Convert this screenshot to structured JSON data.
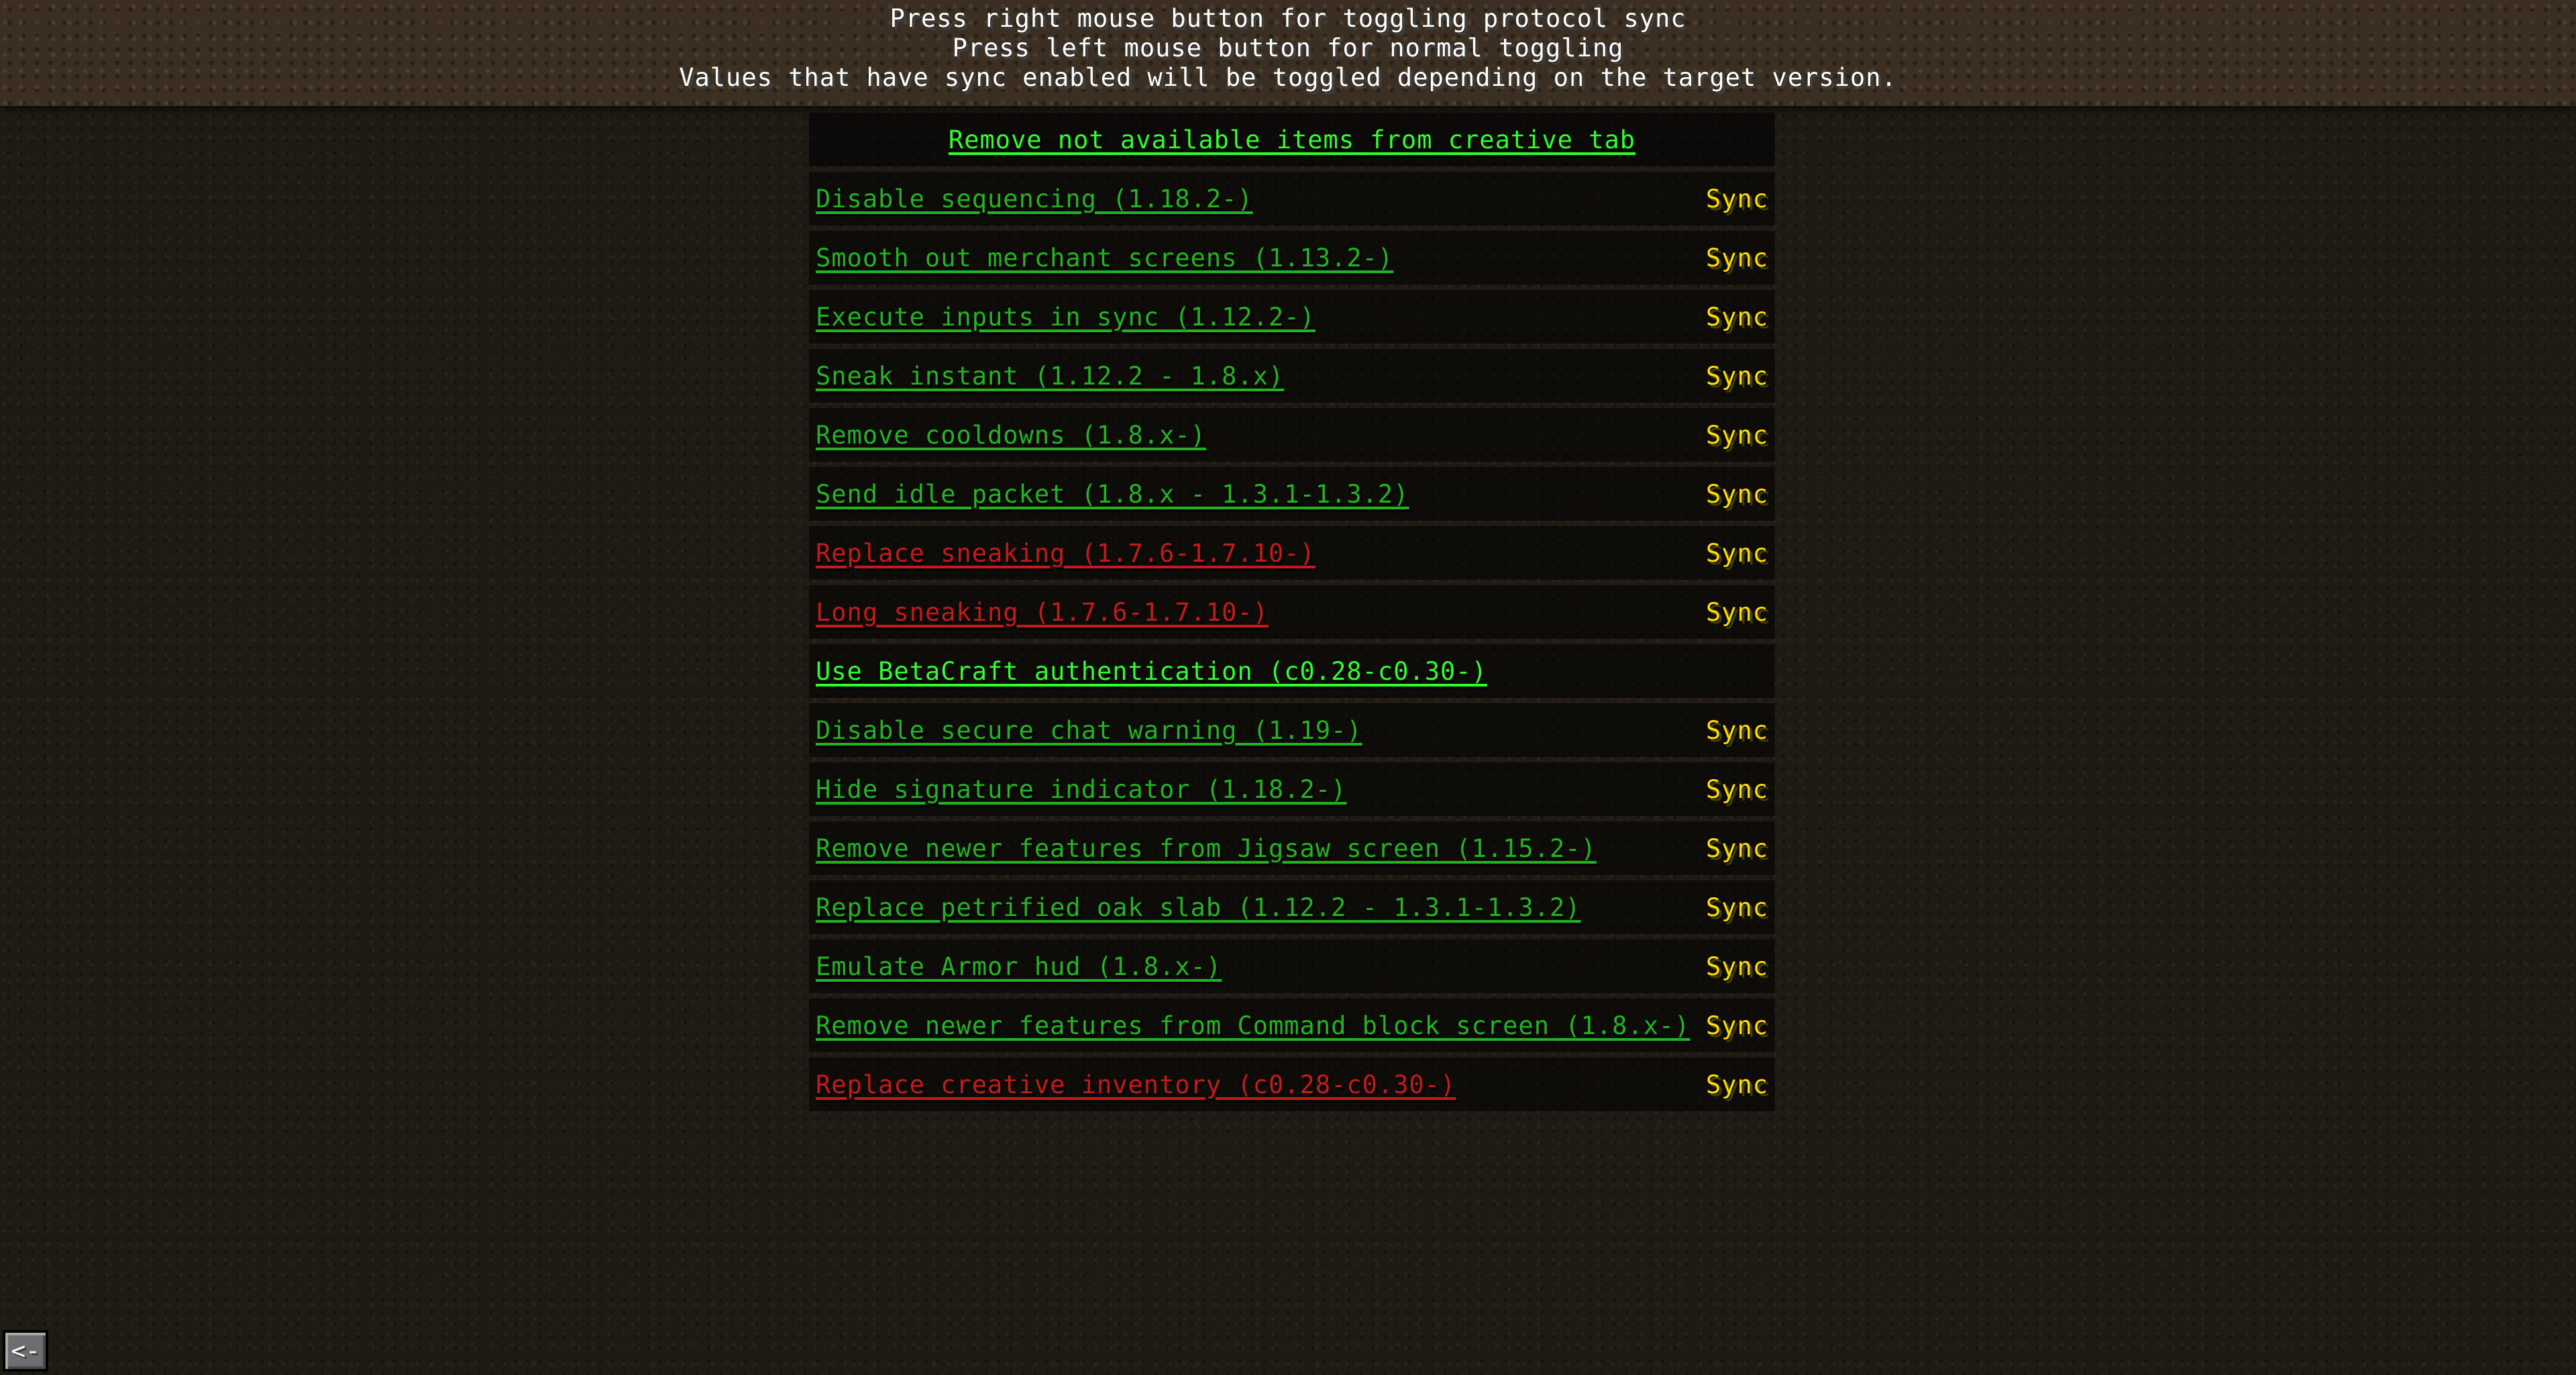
{
  "help": {
    "line1": "Press right mouse button for toggling protocol sync",
    "line2": "Press left mouse button for normal toggling",
    "line3": "Values that have sync enabled will be toggled depending on the target version."
  },
  "colors": {
    "header_green": "#2eff2e",
    "enabled_green": "#22b322",
    "disabled_red": "#c41a1a",
    "sync_yellow": "#ffdd00"
  },
  "settings": [
    {
      "label": "Remove not available items from creative tab",
      "state": "header"
    },
    {
      "label": "Disable sequencing (1.18.2-)",
      "state": "enabled",
      "sync": "Sync"
    },
    {
      "label": "Smooth out merchant screens (1.13.2-)",
      "state": "enabled",
      "sync": "Sync"
    },
    {
      "label": "Execute inputs in sync (1.12.2-)",
      "state": "enabled",
      "sync": "Sync"
    },
    {
      "label": "Sneak instant (1.12.2 - 1.8.x)",
      "state": "enabled",
      "sync": "Sync"
    },
    {
      "label": "Remove cooldowns (1.8.x-)",
      "state": "enabled",
      "sync": "Sync"
    },
    {
      "label": "Send idle packet (1.8.x - 1.3.1-1.3.2)",
      "state": "enabled",
      "sync": "Sync"
    },
    {
      "label": "Replace sneaking (1.7.6-1.7.10-)",
      "state": "disabled",
      "sync": "Sync"
    },
    {
      "label": "Long sneaking (1.7.6-1.7.10-)",
      "state": "disabled",
      "sync": "Sync"
    },
    {
      "label": "Use BetaCraft authentication (c0.28-c0.30-)",
      "state": "solo"
    },
    {
      "label": "Disable secure chat warning (1.19-)",
      "state": "enabled",
      "sync": "Sync"
    },
    {
      "label": "Hide signature indicator (1.18.2-)",
      "state": "enabled",
      "sync": "Sync"
    },
    {
      "label": "Remove newer features from Jigsaw screen (1.15.2-)",
      "state": "enabled",
      "sync": "Sync"
    },
    {
      "label": "Replace petrified oak slab (1.12.2 - 1.3.1-1.3.2)",
      "state": "enabled",
      "sync": "Sync"
    },
    {
      "label": "Emulate Armor hud (1.8.x-)",
      "state": "enabled",
      "sync": "Sync"
    },
    {
      "label": "Remove newer features from Command block screen (1.8.x-)",
      "state": "enabled",
      "sync": "Sync"
    },
    {
      "label": "Replace creative inventory (c0.28-c0.30-)",
      "state": "disabled",
      "sync": "Sync"
    }
  ],
  "back_button": {
    "label": "<-",
    "icon": "back-arrow-icon"
  }
}
